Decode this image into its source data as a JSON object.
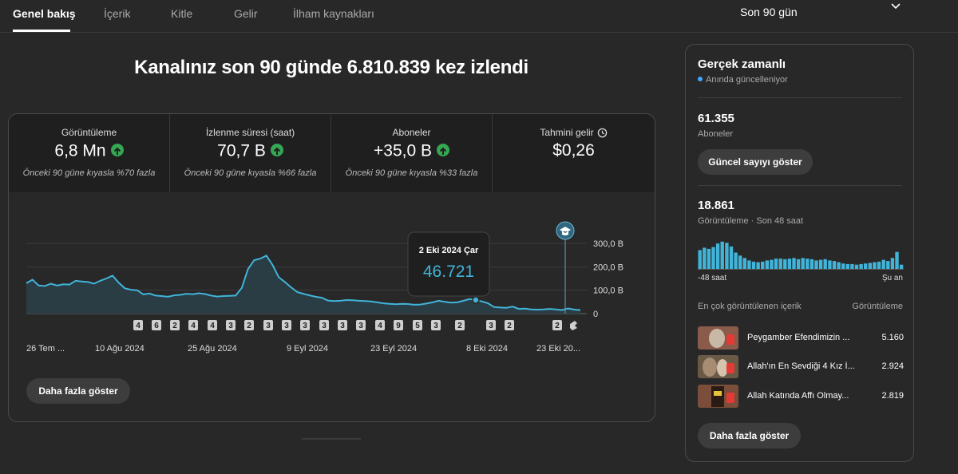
{
  "tabs": [
    {
      "label": "Genel bakış",
      "active": true
    },
    {
      "label": "İçerik"
    },
    {
      "label": "Kitle"
    },
    {
      "label": "Gelir"
    },
    {
      "label": "İlham kaynakları"
    }
  ],
  "period": {
    "label": "Son 90 gün"
  },
  "headline": "Kanalınız son 90 günde 6.810.839 kez izlendi",
  "metrics": [
    {
      "label": "Görüntüleme",
      "value": "6,8 Mn",
      "trend": "up",
      "comparison": "Önceki 90 güne kıyasla %70 fazla"
    },
    {
      "label": "İzlenme süresi (saat)",
      "value": "70,7 B",
      "trend": "up",
      "comparison": "Önceki 90 güne kıyasla %66 fazla"
    },
    {
      "label": "Aboneler",
      "value": "+35,0 B",
      "trend": "up",
      "comparison": "Önceki 90 güne kıyasla %33 fazla"
    },
    {
      "label": "Tahmini gelir",
      "value": "$0,26",
      "icon": "clock-icon"
    }
  ],
  "chart_data": {
    "type": "area",
    "y_tick_labels": [
      "300,0 B",
      "200,0 B",
      "100,0 B",
      "0"
    ],
    "ylim": [
      0,
      300000
    ],
    "x_tick_labels": [
      "26 Tem ...",
      "10 Ağu 2024",
      "25 Ağu 2024",
      "9 Eyl 2024",
      "23 Eyl 2024",
      "8 Eki 2024",
      "23 Eki 20..."
    ],
    "values": [
      130000,
      145000,
      120000,
      118000,
      128000,
      120000,
      125000,
      124000,
      140000,
      137000,
      135000,
      128000,
      140000,
      150000,
      162000,
      132000,
      108000,
      102000,
      100000,
      82000,
      86000,
      77000,
      75000,
      72000,
      78000,
      80000,
      85000,
      83000,
      87000,
      84000,
      77000,
      73000,
      75000,
      76000,
      77000,
      110000,
      190000,
      228000,
      235000,
      248000,
      208000,
      155000,
      135000,
      112000,
      92000,
      85000,
      78000,
      72000,
      68000,
      56000,
      54000,
      55000,
      58000,
      57000,
      55000,
      54000,
      52000,
      48000,
      44000,
      42000,
      40000,
      42000,
      41000,
      38000,
      39000,
      43000,
      48000,
      55000,
      50000,
      47000,
      48000,
      55000,
      62000,
      58000,
      52000,
      44000,
      28000,
      26000,
      25000,
      30000,
      20000,
      21000,
      18000,
      17000,
      18000,
      20000,
      18000,
      15000,
      22000,
      17000,
      15000
    ],
    "tooltip": {
      "date": "2 Eki 2024 Çar",
      "value": "46.721",
      "index": 73
    },
    "markers": [
      "4",
      "6",
      "2",
      "4",
      "4",
      "3",
      "2",
      "3",
      "3",
      "3",
      "3",
      "3",
      "3",
      "4",
      "9",
      "5",
      "3",
      "2",
      "3",
      "2"
    ],
    "line_color": "#41b4d9",
    "fill_color": "#2a3c44",
    "event_icon": "graduation-cap-icon"
  },
  "more_button": "Daha fazla göster",
  "realtime": {
    "title": "Gerçek zamanlı",
    "live_label": "Anında güncelleniyor",
    "subscribers": {
      "value": "61.355",
      "label": "Aboneler",
      "button": "Güncel sayıyı göster"
    },
    "views": {
      "value": "18.861",
      "label": "Görüntüleme · Son 48 saat"
    },
    "mini_chart": {
      "type": "bar",
      "values": [
        62,
        70,
        66,
        72,
        84,
        90,
        86,
        74,
        54,
        44,
        36,
        28,
        24,
        22,
        24,
        28,
        30,
        34,
        34,
        32,
        34,
        36,
        32,
        36,
        34,
        32,
        28,
        30,
        32,
        28,
        26,
        22,
        18,
        16,
        16,
        14,
        16,
        18,
        20,
        22,
        24,
        30,
        26,
        36,
        56,
        14
      ],
      "x_start_label": "-48 saat",
      "x_end_label": "Şu an",
      "bar_color": "#41b4d9"
    },
    "top_content": {
      "header_left": "En çok görüntülenen içerik",
      "header_right": "Görüntüleme",
      "items": [
        {
          "title": "Peygamber Efendimizin ...",
          "views": "5.160",
          "thumb_color": "#8a5a4a"
        },
        {
          "title": "Allah'ın En Sevdiği 4 Kız İ...",
          "views": "2.924",
          "thumb_color": "#6b5948"
        },
        {
          "title": "Allah Katında Affı Olmay...",
          "views": "2.819",
          "thumb_color": "#7a4e3a"
        }
      ]
    },
    "more_button": "Daha fazla göster"
  }
}
